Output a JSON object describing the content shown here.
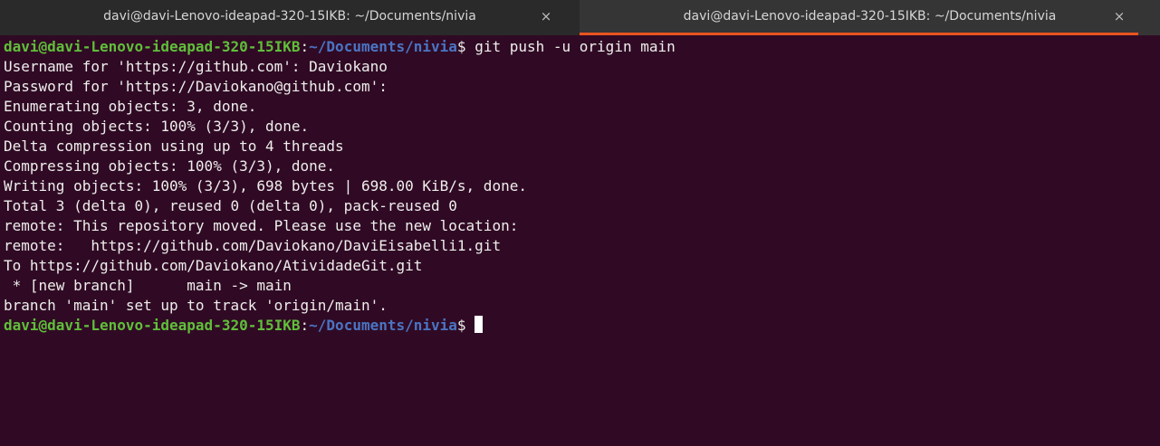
{
  "tabs": [
    {
      "title": "davi@davi-Lenovo-ideapad-320-15IKB: ~/Documents/nivia",
      "close": "×",
      "active": false
    },
    {
      "title": "davi@davi-Lenovo-ideapad-320-15IKB: ~/Documents/nivia",
      "close": "×",
      "active": true
    }
  ],
  "colors": {
    "background": "#300a24",
    "prompt_user": "#5fbf3a",
    "prompt_path": "#4a75c4",
    "text": "#eeeeec",
    "tab_active_underline": "#e95420"
  },
  "prompt": {
    "user_host": "davi@davi-Lenovo-ideapad-320-15IKB",
    "separator": ":",
    "path": "~/Documents/nivia",
    "symbol": "$ "
  },
  "command": "git push -u origin main",
  "output": [
    "Username for 'https://github.com': Daviokano",
    "Password for 'https://Daviokano@github.com': ",
    "Enumerating objects: 3, done.",
    "Counting objects: 100% (3/3), done.",
    "Delta compression using up to 4 threads",
    "Compressing objects: 100% (3/3), done.",
    "Writing objects: 100% (3/3), 698 bytes | 698.00 KiB/s, done.",
    "Total 3 (delta 0), reused 0 (delta 0), pack-reused 0",
    "remote: This repository moved. Please use the new location:",
    "remote:   https://github.com/Daviokano/DaviEisabelli1.git",
    "To https://github.com/Daviokano/AtividadeGit.git",
    " * [new branch]      main -> main",
    "branch 'main' set up to track 'origin/main'."
  ]
}
